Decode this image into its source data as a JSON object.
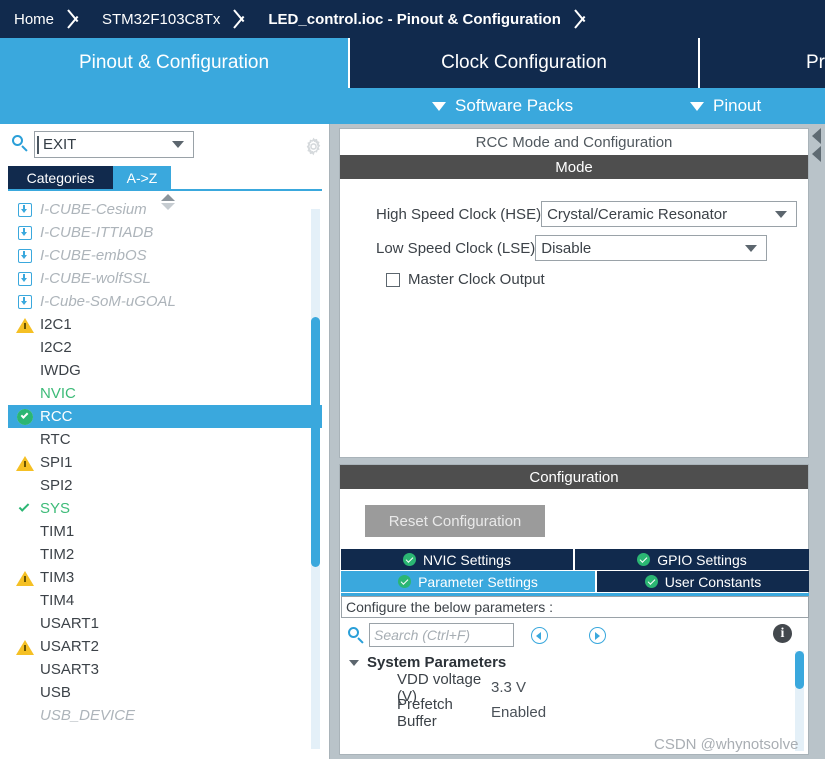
{
  "breadcrumb": {
    "items": [
      {
        "label": "Home",
        "active": false
      },
      {
        "label": "STM32F103C8Tx",
        "active": false
      },
      {
        "label": "LED_control.ioc - Pinout & Configuration",
        "active": true
      }
    ]
  },
  "main_tabs": [
    {
      "label": "Pinout & Configuration",
      "selected": true
    },
    {
      "label": "Clock Configuration",
      "selected": false
    },
    {
      "label": "Pr",
      "selected": false
    }
  ],
  "subbar": {
    "software_packs": "Software Packs",
    "pinout": "Pinout"
  },
  "sidebar": {
    "search": {
      "value": "EXIT",
      "icon": "search-icon"
    },
    "gear_icon": "gear-icon",
    "tabs": [
      {
        "label": "Categories",
        "selected": false
      },
      {
        "label": "A->Z",
        "selected": true
      }
    ],
    "peripherals": [
      {
        "label": "I-CUBE-Cesium",
        "icon": "download",
        "state": "pack",
        "clipped": true
      },
      {
        "label": "I-CUBE-ITTIADB",
        "icon": "download",
        "state": "pack"
      },
      {
        "label": "I-CUBE-embOS",
        "icon": "download",
        "state": "pack"
      },
      {
        "label": "I-CUBE-wolfSSL",
        "icon": "download",
        "state": "pack"
      },
      {
        "label": "I-Cube-SoM-uGOAL",
        "icon": "download",
        "state": "pack"
      },
      {
        "label": "I2C1",
        "icon": "warning",
        "state": "normal"
      },
      {
        "label": "I2C2",
        "icon": "none",
        "state": "normal"
      },
      {
        "label": "IWDG",
        "icon": "none",
        "state": "normal"
      },
      {
        "label": "NVIC",
        "icon": "none",
        "state": "configured"
      },
      {
        "label": "RCC",
        "icon": "check-circle",
        "state": "selected"
      },
      {
        "label": "RTC",
        "icon": "none",
        "state": "normal"
      },
      {
        "label": "SPI1",
        "icon": "warning",
        "state": "normal"
      },
      {
        "label": "SPI2",
        "icon": "none",
        "state": "normal"
      },
      {
        "label": "SYS",
        "icon": "check",
        "state": "configured"
      },
      {
        "label": "TIM1",
        "icon": "none",
        "state": "normal"
      },
      {
        "label": "TIM2",
        "icon": "none",
        "state": "normal"
      },
      {
        "label": "TIM3",
        "icon": "warning",
        "state": "normal"
      },
      {
        "label": "TIM4",
        "icon": "none",
        "state": "normal"
      },
      {
        "label": "USART1",
        "icon": "none",
        "state": "normal"
      },
      {
        "label": "USART2",
        "icon": "warning",
        "state": "normal"
      },
      {
        "label": "USART3",
        "icon": "none",
        "state": "normal"
      },
      {
        "label": "USB",
        "icon": "none",
        "state": "normal"
      },
      {
        "label": "USB_DEVICE",
        "icon": "none",
        "state": "pack",
        "clipped": true
      }
    ]
  },
  "mode_panel": {
    "title": "RCC Mode and Configuration",
    "section": "Mode",
    "hse": {
      "label": "High Speed Clock (HSE)",
      "value": "Crystal/Ceramic Resonator"
    },
    "lse": {
      "label": "Low Speed Clock (LSE)",
      "value": "Disable"
    },
    "mco": {
      "label": "Master Clock Output",
      "checked": false
    }
  },
  "config_panel": {
    "section": "Configuration",
    "reset_button": "Reset Configuration",
    "tabs": [
      {
        "label": "NVIC Settings",
        "active": false
      },
      {
        "label": "GPIO Settings",
        "active": false
      },
      {
        "label": "Parameter Settings",
        "active": true
      },
      {
        "label": "User Constants",
        "active": false
      }
    ],
    "hint": "Configure the below parameters :",
    "search_placeholder": "Search (Ctrl+F)",
    "prev_icon": "chevron-left-circle-icon",
    "next_icon": "chevron-right-circle-icon",
    "info_icon": "info-icon",
    "info_glyph": "i",
    "tree": {
      "group": "System Parameters",
      "rows": [
        {
          "name": "VDD voltage (V)",
          "value": "3.3 V"
        },
        {
          "name": "Prefetch Buffer",
          "value": "Enabled"
        }
      ]
    }
  },
  "watermark": "CSDN @whynotsolve",
  "colors": {
    "navy": "#112a4d",
    "accent_blue": "#3aa8dd",
    "dark_bar": "#4e4e4e",
    "green": "#2bb673",
    "warning": "#f5c024"
  }
}
